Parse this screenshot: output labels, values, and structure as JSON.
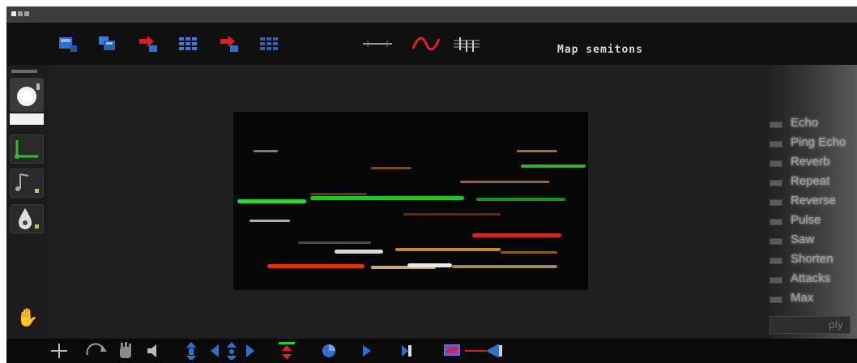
{
  "toolbar": {
    "map_label": "Map semitons",
    "icons": [
      "view-single-icon",
      "view-multi-icon",
      "red-arrow-icon",
      "grid-icon",
      "red-arrow-icon-2",
      "grid-icon-2",
      "line-tool-icon",
      "wave-icon",
      "notes-icon"
    ]
  },
  "left_panel": {
    "tools": [
      "light-bulb-icon",
      "axes-icon",
      "music-note-icon",
      "drop-icon",
      "hand-icon"
    ]
  },
  "effects": {
    "items": [
      {
        "label": "Echo",
        "checked": false
      },
      {
        "label": "Ping Echo",
        "checked": false
      },
      {
        "label": "Reverb",
        "checked": false
      },
      {
        "label": "Repeat",
        "checked": false
      },
      {
        "label": "Reverse",
        "checked": false
      },
      {
        "label": "Pulse",
        "checked": false
      },
      {
        "label": "Saw",
        "checked": false
      },
      {
        "label": "Shorten",
        "checked": false
      },
      {
        "label": "Attacks",
        "checked": false
      },
      {
        "label": "Max",
        "checked": false
      }
    ],
    "apply_label": "ply"
  },
  "bottom_bar": {
    "icons": [
      "move-icon",
      "rotate-icon",
      "pan-hand-icon",
      "speaker-icon",
      "vertical-scroll-icon",
      "left-arrow-icon",
      "nav-cross-icon",
      "right-arrow-icon",
      "fit-vertical-icon",
      "play-icon",
      "forward-icon",
      "rewind-end-icon",
      "monitor-icon",
      "volume-icon"
    ]
  },
  "colors": {
    "accent_blue": "#2f6fd0",
    "accent_red": "#e02020",
    "accent_green": "#2dcf2d"
  }
}
